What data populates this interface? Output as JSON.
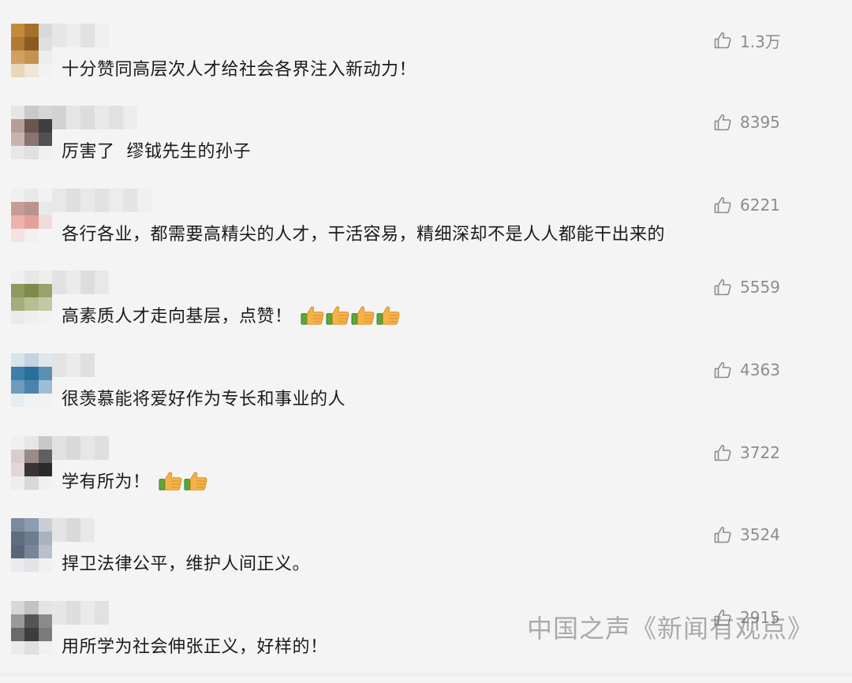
{
  "comments": [
    {
      "text": "十分赞同高层次人才给社会各界注入新动力！",
      "likes": "1.3万",
      "emoji_count": 0,
      "avatar": [
        "#c48a3a",
        "#a66f2a",
        "#d9d9d9",
        "#b07a35",
        "#8a5a22",
        "#e0e0e0",
        "#d2a062",
        "#c5934f",
        "#ededed",
        "#e8d6b8",
        "#efe6d6",
        "#f2f2f2"
      ],
      "name": [
        "#e6e6e6",
        "#ededed",
        "#e2e2e2",
        "#efefef"
      ]
    },
    {
      "text": "厉害了  缪钺先生的孙子",
      "likes": "8395",
      "emoji_count": 0,
      "avatar": [
        "#e5e5e5",
        "#c9c9c9",
        "#d6d6d6",
        "#b89e98",
        "#6a5550",
        "#3e3e3e",
        "#c8b3ae",
        "#8a7370",
        "#505050",
        "#e7e7e7",
        "#e0e0e0",
        "#f0f0f0"
      ],
      "name": [
        "#d2d2d2",
        "#e5e5e5",
        "#dcdcdc",
        "#e9e9e9",
        "#e1e1e1",
        "#ececec"
      ]
    },
    {
      "text": "各行各业，都需要高精尖的人才，干活容易，精细深却不是人人都能干出来的",
      "likes": "6221",
      "emoji_count": 0,
      "avatar": [
        "#f0f0f0",
        "#e9e9e9",
        "#f2f2f2",
        "#c89c95",
        "#b9938c",
        "#e9e9e9",
        "#eeb1ad",
        "#e6a09b",
        "#f0dcda",
        "#f3e2e0",
        "#f1f1f1",
        "#f4f4f4"
      ],
      "name": [
        "#e8e8e8",
        "#dfdfdf",
        "#e9e9e9",
        "#e2e2e2",
        "#ececec",
        "#e4e4e4",
        "#efefef"
      ]
    },
    {
      "text": "高素质人才走向基层，点赞！",
      "likes": "5559",
      "emoji_count": 4,
      "avatar": [
        "#f0f0f0",
        "#e7e7e7",
        "#eeeeee",
        "#8d9a5e",
        "#7d8a4c",
        "#9aa46a",
        "#a4ad7b",
        "#b6bf8f",
        "#c3c9a2",
        "#eaeaea",
        "#efefef",
        "#f2f2f2"
      ],
      "name": [
        "#e2e2e2",
        "#ebebeb",
        "#dddddd",
        "#e8e8e8"
      ]
    },
    {
      "text": "很羡慕能将爱好作为专长和事业的人",
      "likes": "4363",
      "emoji_count": 0,
      "avatar": [
        "#d9e3ea",
        "#c4d3df",
        "#dfe6ec",
        "#3d7fa8",
        "#2a6e9a",
        "#5a8fb2",
        "#6d9bbb",
        "#4a84ad",
        "#9fbdd2",
        "#e6ecf0",
        "#eef2f4",
        "#f2f2f2"
      ],
      "name": [
        "#e3e3e3",
        "#eaeaea",
        "#e0e0e0"
      ]
    },
    {
      "text": "学有所为！",
      "likes": "3722",
      "emoji_count": 2,
      "avatar": [
        "#f0f0f0",
        "#e6e6e6",
        "#c8c8c8",
        "#d8cccc",
        "#9a8a8a",
        "#606060",
        "#e2d6d6",
        "#3a3434",
        "#2a2a2a",
        "#eeeeee",
        "#d8d8d8",
        "#f0f0f0"
      ],
      "name": [
        "#e1e1e1",
        "#d9d9d9",
        "#e6e6e6",
        "#dedede"
      ]
    },
    {
      "text": "捍卫法律公平，维护人间正义。",
      "likes": "3524",
      "emoji_count": 0,
      "avatar": [
        "#7a8aa0",
        "#8d9cb0",
        "#c9ced6",
        "#5f6d80",
        "#6f7c8e",
        "#a9b3c0",
        "#5a6677",
        "#77849a",
        "#b8c0cb",
        "#e8eaed",
        "#e2e4e8",
        "#f0f0f0"
      ],
      "name": [
        "#e4e4e4",
        "#dadada",
        "#e8e8e8"
      ]
    },
    {
      "text": "用所学为社会伸张正义，好样的！",
      "likes": "2915",
      "emoji_count": 0,
      "avatar": [
        "#d8d8d8",
        "#c2c2c2",
        "#e4e4e4",
        "#9a9a9a",
        "#555555",
        "#8a8a8a",
        "#6a6a6a",
        "#3d3d3d",
        "#7a7a7a",
        "#ebebeb",
        "#e0e0e0",
        "#f0f0f0"
      ],
      "name": [
        "#e6e6e6",
        "#dddddd",
        "#eaeaea",
        "#e1e1e1"
      ]
    }
  ],
  "watermark": "中国之声《新闻有观点》",
  "colors": {
    "text": "#1b1b1b",
    "like_text": "#8c8c8c",
    "background": "#f4f4f4"
  }
}
